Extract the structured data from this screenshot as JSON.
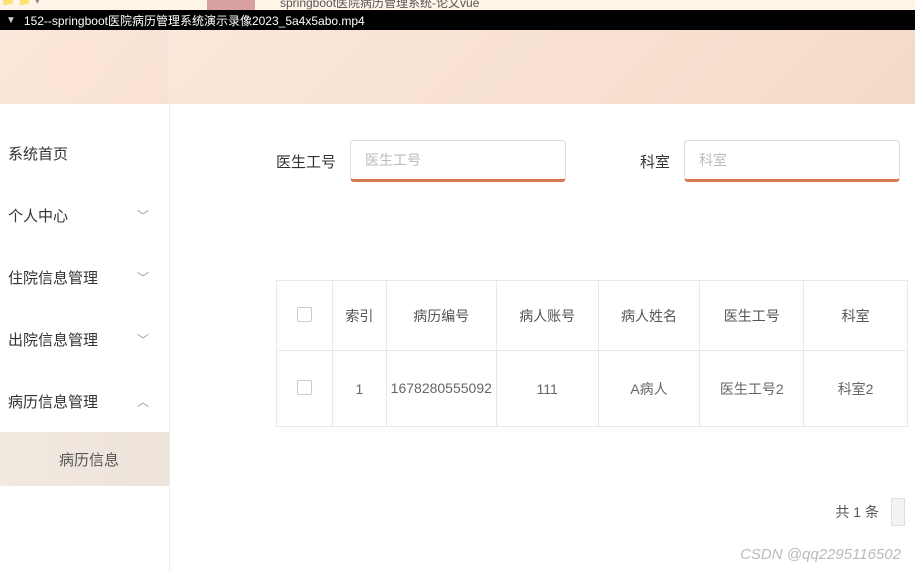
{
  "titlebar": {
    "top_text": "springboot医院病历管理系统-论文vue",
    "filename": "152--springboot医院病历管理系统演示录像2023_5a4x5abo.mp4"
  },
  "sidebar": {
    "items": [
      {
        "label": "系统首页",
        "expandable": false
      },
      {
        "label": "个人中心",
        "expandable": true,
        "expanded": false
      },
      {
        "label": "住院信息管理",
        "expandable": true,
        "expanded": false
      },
      {
        "label": "出院信息管理",
        "expandable": true,
        "expanded": false
      },
      {
        "label": "病历信息管理",
        "expandable": true,
        "expanded": true
      }
    ],
    "submenu": {
      "label": "病历信息"
    }
  },
  "search": {
    "doctor_label": "医生工号",
    "doctor_placeholder": "医生工号",
    "dept_label": "科室",
    "dept_placeholder": "科室"
  },
  "table": {
    "headers": {
      "index": "索引",
      "record_code": "病历编号",
      "patient_account": "病人账号",
      "patient_name": "病人姓名",
      "doctor_id": "医生工号",
      "department": "科室"
    },
    "rows": [
      {
        "index": "1",
        "record_code": "1678280555092",
        "patient_account": "111",
        "patient_name": "A病人",
        "doctor_id": "医生工号2",
        "department": "科室2"
      }
    ]
  },
  "pagination": {
    "total_text": "共 1 条"
  },
  "watermark": "CSDN @qq2295116502"
}
